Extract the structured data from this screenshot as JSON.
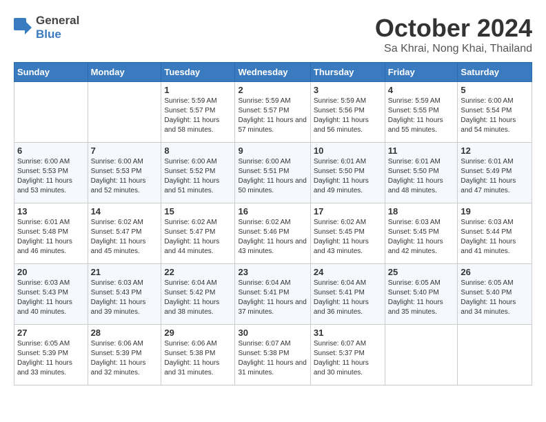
{
  "logo": {
    "general": "General",
    "blue": "Blue"
  },
  "title": "October 2024",
  "location": "Sa Khrai, Nong Khai, Thailand",
  "headers": [
    "Sunday",
    "Monday",
    "Tuesday",
    "Wednesday",
    "Thursday",
    "Friday",
    "Saturday"
  ],
  "weeks": [
    [
      {
        "day": "",
        "sunrise": "",
        "sunset": "",
        "daylight": ""
      },
      {
        "day": "",
        "sunrise": "",
        "sunset": "",
        "daylight": ""
      },
      {
        "day": "1",
        "sunrise": "Sunrise: 5:59 AM",
        "sunset": "Sunset: 5:57 PM",
        "daylight": "Daylight: 11 hours and 58 minutes."
      },
      {
        "day": "2",
        "sunrise": "Sunrise: 5:59 AM",
        "sunset": "Sunset: 5:57 PM",
        "daylight": "Daylight: 11 hours and 57 minutes."
      },
      {
        "day": "3",
        "sunrise": "Sunrise: 5:59 AM",
        "sunset": "Sunset: 5:56 PM",
        "daylight": "Daylight: 11 hours and 56 minutes."
      },
      {
        "day": "4",
        "sunrise": "Sunrise: 5:59 AM",
        "sunset": "Sunset: 5:55 PM",
        "daylight": "Daylight: 11 hours and 55 minutes."
      },
      {
        "day": "5",
        "sunrise": "Sunrise: 6:00 AM",
        "sunset": "Sunset: 5:54 PM",
        "daylight": "Daylight: 11 hours and 54 minutes."
      }
    ],
    [
      {
        "day": "6",
        "sunrise": "Sunrise: 6:00 AM",
        "sunset": "Sunset: 5:53 PM",
        "daylight": "Daylight: 11 hours and 53 minutes."
      },
      {
        "day": "7",
        "sunrise": "Sunrise: 6:00 AM",
        "sunset": "Sunset: 5:53 PM",
        "daylight": "Daylight: 11 hours and 52 minutes."
      },
      {
        "day": "8",
        "sunrise": "Sunrise: 6:00 AM",
        "sunset": "Sunset: 5:52 PM",
        "daylight": "Daylight: 11 hours and 51 minutes."
      },
      {
        "day": "9",
        "sunrise": "Sunrise: 6:00 AM",
        "sunset": "Sunset: 5:51 PM",
        "daylight": "Daylight: 11 hours and 50 minutes."
      },
      {
        "day": "10",
        "sunrise": "Sunrise: 6:01 AM",
        "sunset": "Sunset: 5:50 PM",
        "daylight": "Daylight: 11 hours and 49 minutes."
      },
      {
        "day": "11",
        "sunrise": "Sunrise: 6:01 AM",
        "sunset": "Sunset: 5:50 PM",
        "daylight": "Daylight: 11 hours and 48 minutes."
      },
      {
        "day": "12",
        "sunrise": "Sunrise: 6:01 AM",
        "sunset": "Sunset: 5:49 PM",
        "daylight": "Daylight: 11 hours and 47 minutes."
      }
    ],
    [
      {
        "day": "13",
        "sunrise": "Sunrise: 6:01 AM",
        "sunset": "Sunset: 5:48 PM",
        "daylight": "Daylight: 11 hours and 46 minutes."
      },
      {
        "day": "14",
        "sunrise": "Sunrise: 6:02 AM",
        "sunset": "Sunset: 5:47 PM",
        "daylight": "Daylight: 11 hours and 45 minutes."
      },
      {
        "day": "15",
        "sunrise": "Sunrise: 6:02 AM",
        "sunset": "Sunset: 5:47 PM",
        "daylight": "Daylight: 11 hours and 44 minutes."
      },
      {
        "day": "16",
        "sunrise": "Sunrise: 6:02 AM",
        "sunset": "Sunset: 5:46 PM",
        "daylight": "Daylight: 11 hours and 43 minutes."
      },
      {
        "day": "17",
        "sunrise": "Sunrise: 6:02 AM",
        "sunset": "Sunset: 5:45 PM",
        "daylight": "Daylight: 11 hours and 43 minutes."
      },
      {
        "day": "18",
        "sunrise": "Sunrise: 6:03 AM",
        "sunset": "Sunset: 5:45 PM",
        "daylight": "Daylight: 11 hours and 42 minutes."
      },
      {
        "day": "19",
        "sunrise": "Sunrise: 6:03 AM",
        "sunset": "Sunset: 5:44 PM",
        "daylight": "Daylight: 11 hours and 41 minutes."
      }
    ],
    [
      {
        "day": "20",
        "sunrise": "Sunrise: 6:03 AM",
        "sunset": "Sunset: 5:43 PM",
        "daylight": "Daylight: 11 hours and 40 minutes."
      },
      {
        "day": "21",
        "sunrise": "Sunrise: 6:03 AM",
        "sunset": "Sunset: 5:43 PM",
        "daylight": "Daylight: 11 hours and 39 minutes."
      },
      {
        "day": "22",
        "sunrise": "Sunrise: 6:04 AM",
        "sunset": "Sunset: 5:42 PM",
        "daylight": "Daylight: 11 hours and 38 minutes."
      },
      {
        "day": "23",
        "sunrise": "Sunrise: 6:04 AM",
        "sunset": "Sunset: 5:41 PM",
        "daylight": "Daylight: 11 hours and 37 minutes."
      },
      {
        "day": "24",
        "sunrise": "Sunrise: 6:04 AM",
        "sunset": "Sunset: 5:41 PM",
        "daylight": "Daylight: 11 hours and 36 minutes."
      },
      {
        "day": "25",
        "sunrise": "Sunrise: 6:05 AM",
        "sunset": "Sunset: 5:40 PM",
        "daylight": "Daylight: 11 hours and 35 minutes."
      },
      {
        "day": "26",
        "sunrise": "Sunrise: 6:05 AM",
        "sunset": "Sunset: 5:40 PM",
        "daylight": "Daylight: 11 hours and 34 minutes."
      }
    ],
    [
      {
        "day": "27",
        "sunrise": "Sunrise: 6:05 AM",
        "sunset": "Sunset: 5:39 PM",
        "daylight": "Daylight: 11 hours and 33 minutes."
      },
      {
        "day": "28",
        "sunrise": "Sunrise: 6:06 AM",
        "sunset": "Sunset: 5:39 PM",
        "daylight": "Daylight: 11 hours and 32 minutes."
      },
      {
        "day": "29",
        "sunrise": "Sunrise: 6:06 AM",
        "sunset": "Sunset: 5:38 PM",
        "daylight": "Daylight: 11 hours and 31 minutes."
      },
      {
        "day": "30",
        "sunrise": "Sunrise: 6:07 AM",
        "sunset": "Sunset: 5:38 PM",
        "daylight": "Daylight: 11 hours and 31 minutes."
      },
      {
        "day": "31",
        "sunrise": "Sunrise: 6:07 AM",
        "sunset": "Sunset: 5:37 PM",
        "daylight": "Daylight: 11 hours and 30 minutes."
      },
      {
        "day": "",
        "sunrise": "",
        "sunset": "",
        "daylight": ""
      },
      {
        "day": "",
        "sunrise": "",
        "sunset": "",
        "daylight": ""
      }
    ]
  ]
}
